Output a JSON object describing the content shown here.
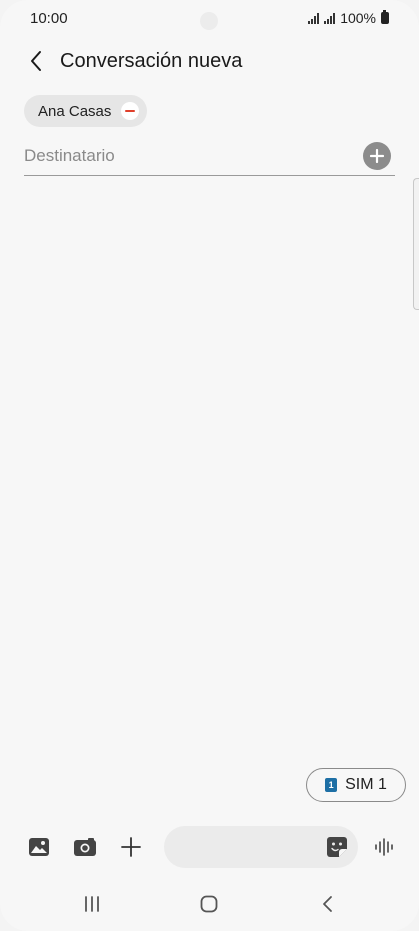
{
  "status_bar": {
    "time": "10:00",
    "battery": "100%"
  },
  "header": {
    "title": "Conversación nueva"
  },
  "recipients": [
    {
      "name": "Ana Casas"
    }
  ],
  "recipient_input": {
    "placeholder": "Destinatario",
    "value": ""
  },
  "sim": {
    "number": "1",
    "label": "SIM 1"
  },
  "composer": {
    "value": ""
  },
  "colors": {
    "remove_accent": "#e0402c",
    "sim_badge": "#1d6fa5",
    "add_button": "#8c8c8c"
  },
  "icons": {
    "back": "chevron-left-icon",
    "remove": "minus-circle-icon",
    "add_contact": "plus-circle-icon",
    "gallery": "image-icon",
    "camera": "camera-icon",
    "attach": "plus-icon",
    "sticker": "sticker-icon",
    "voice": "voice-wave-icon",
    "recents": "recents-icon",
    "home": "home-icon",
    "nav_back": "nav-back-icon"
  }
}
